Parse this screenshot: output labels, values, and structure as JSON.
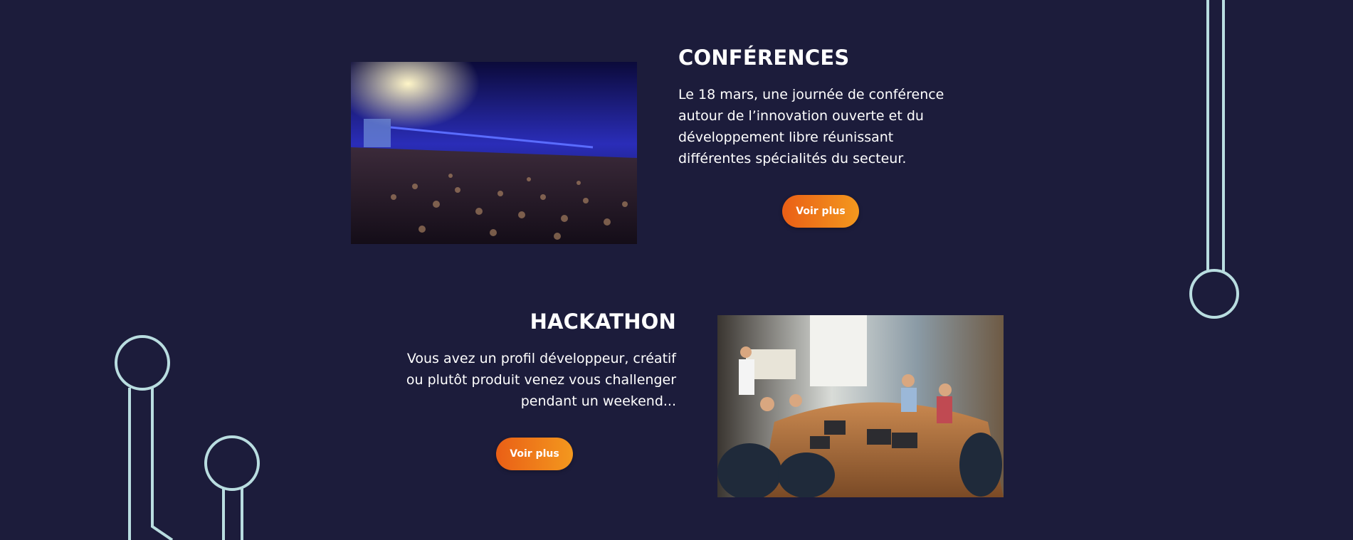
{
  "conferences": {
    "title": "CONFÉRENCES",
    "text": "Le 18 mars, une journée de conférence autour de l’innovation ouverte et du développement libre réunissant différentes spécialités du secteur.",
    "button_label": "Voir plus"
  },
  "hackathon": {
    "title": "HACKATHON",
    "text": "Vous avez un profil développeur, créatif ou plutôt produit venez vous challenger pendant un weekend...",
    "button_label": "Voir plus"
  },
  "colors": {
    "background": "#1c1c3b",
    "circuit_lines": "#b9dde0",
    "button_gradient_start": "#ea5f16",
    "button_gradient_end": "#f3981e",
    "text": "#ffffff"
  }
}
